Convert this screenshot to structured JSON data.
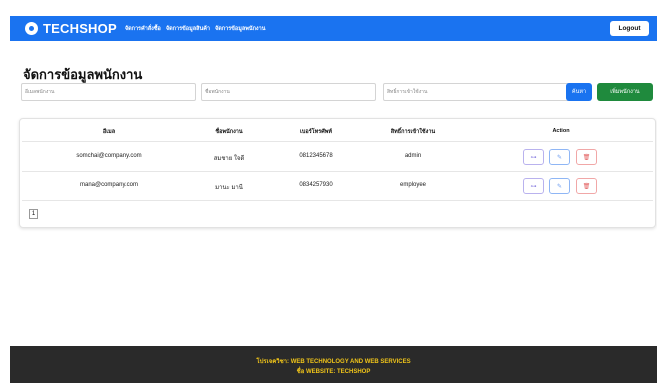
{
  "navbar": {
    "brand": "TECHSHOP",
    "links": [
      "จัดการคำสั่งซื้อ",
      "จัดการข้อมูลสินค้า",
      "จัดการข้อมูลพนักงาน"
    ],
    "logout_label": "Logout",
    "color": "#1a73f0"
  },
  "page": {
    "title": "จัดการข้อมูลพนักงาน"
  },
  "filters": {
    "email_placeholder": "อีเมลพนักงาน",
    "name_placeholder": "ชื่อพนักงาน",
    "role_placeholder": "สิทธิ์การเข้าใช้งาน",
    "search_label": "ค้นหา",
    "add_label": "เพิ่มพนักงาน"
  },
  "table": {
    "headers": [
      "อีเมล",
      "ชื่อพนักงาน",
      "เบอร์โทรศัพท์",
      "สิทธิ์การเข้าใช้งาน",
      "Action"
    ],
    "rows": [
      {
        "email": "somchai@company.com",
        "name": "สมชาย ใจดี",
        "phone": "0812345678",
        "role": "admin"
      },
      {
        "email": "mana@company.com",
        "name": "มานะ มานี",
        "phone": "0834257930",
        "role": "employee"
      }
    ],
    "actions": {
      "key_icon": "key-icon",
      "edit_icon": "pencil-icon",
      "delete_icon": "trash-icon"
    }
  },
  "pagination": {
    "current_page": "1"
  },
  "footer": {
    "line1": "โปรเจควิชา: WEB TECHNOLOGY AND WEB SERVICES",
    "line2": "ชื่อ WEBSITE: TECHSHOP"
  }
}
